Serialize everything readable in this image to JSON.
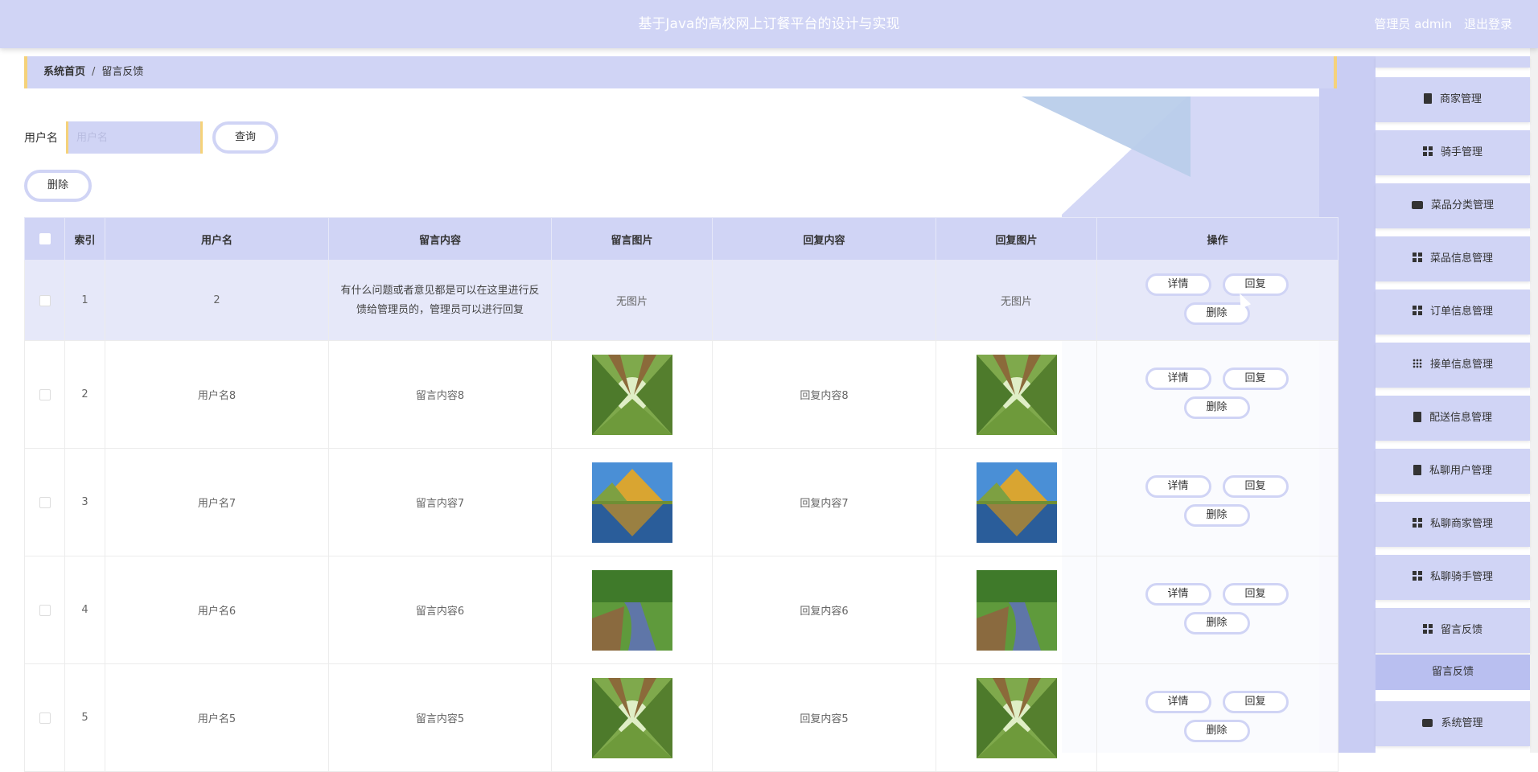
{
  "header": {
    "title": "基于Java的高校网上订餐平台的设计与实现",
    "admin_label": "管理员 admin",
    "logout_label": "退出登录"
  },
  "breadcrumb": {
    "home": "系统首页",
    "separator": "/",
    "current": "留言反馈"
  },
  "search": {
    "label": "用户名",
    "placeholder": "用户名",
    "query_button": "查询"
  },
  "toolbar": {
    "delete_button": "删除"
  },
  "table": {
    "headers": [
      "索引",
      "用户名",
      "留言内容",
      "留言图片",
      "回复内容",
      "回复图片",
      "操作"
    ],
    "ops": {
      "detail": "详情",
      "reply": "回复",
      "delete": "删除"
    },
    "rows": [
      {
        "index": "1",
        "username": "2",
        "content": "有什么问题或者意见都是可以在这里进行反馈给管理员的，管理员可以进行回复",
        "image": "无图片",
        "reply": "",
        "reply_image": "无图片"
      },
      {
        "index": "2",
        "username": "用户名8",
        "content": "留言内容8",
        "image": "forest-image",
        "reply": "回复内容8",
        "reply_image": "forest-image"
      },
      {
        "index": "3",
        "username": "用户名7",
        "content": "留言内容7",
        "image": "mountain-lake-image",
        "reply": "回复内容7",
        "reply_image": "mountain-lake-image"
      },
      {
        "index": "4",
        "username": "用户名6",
        "content": "留言内容6",
        "image": "river-image",
        "reply": "回复内容6",
        "reply_image": "river-image"
      },
      {
        "index": "5",
        "username": "用户名5",
        "content": "留言内容5",
        "image": "forest-image",
        "reply": "回复内容5",
        "reply_image": "forest-image"
      }
    ]
  },
  "sidebar": {
    "items": [
      {
        "label": "商家管理",
        "icon": "clipboard-x-icon"
      },
      {
        "label": "骑手管理",
        "icon": "grid-icon"
      },
      {
        "label": "菜品分类管理",
        "icon": "briefcase-icon"
      },
      {
        "label": "菜品信息管理",
        "icon": "grid-icon"
      },
      {
        "label": "订单信息管理",
        "icon": "grid-icon"
      },
      {
        "label": "接单信息管理",
        "icon": "apps-icon"
      },
      {
        "label": "配送信息管理",
        "icon": "clipboard-check-icon"
      },
      {
        "label": "私聊用户管理",
        "icon": "clipboard-icon"
      },
      {
        "label": "私聊商家管理",
        "icon": "grid-icon"
      },
      {
        "label": "私聊骑手管理",
        "icon": "grid-icon"
      },
      {
        "label": "留言反馈",
        "icon": "grid-icon"
      },
      {
        "label": "系统管理",
        "icon": "chat-icon"
      }
    ],
    "active_sub": "留言反馈"
  },
  "colors": {
    "accent": "#d0d4f5",
    "border_accent": "#f5d27a",
    "sub_active": "#b9bff0"
  }
}
